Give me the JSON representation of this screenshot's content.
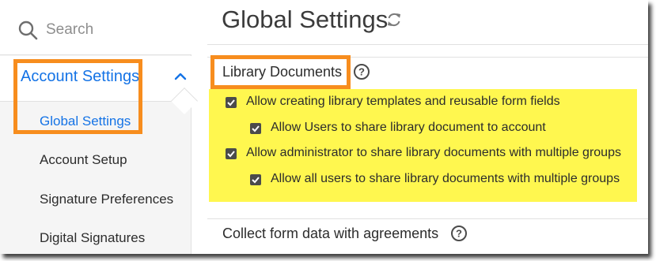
{
  "sidebar": {
    "search_label": "Search",
    "section": "Account Settings",
    "items": [
      {
        "label": "Global Settings",
        "active": true
      },
      {
        "label": "Account Setup",
        "active": false
      },
      {
        "label": "Signature Preferences",
        "active": false
      },
      {
        "label": "Digital Signatures",
        "active": false
      }
    ]
  },
  "main": {
    "title": "Global Settings",
    "library": {
      "title": "Library Documents",
      "options": [
        {
          "label": "Allow creating library templates and reusable form fields",
          "checked": true
        },
        {
          "label": "Allow Users to share library document to account",
          "checked": true
        },
        {
          "label": "Allow administrator to share library documents with multiple groups",
          "checked": true
        },
        {
          "label": "Allow all users to share library documents with multiple groups",
          "checked": true
        }
      ]
    },
    "collect": {
      "title": "Collect form data with agreements"
    }
  },
  "colors": {
    "accent": "#1473e6",
    "highlight_box": "#f78d1e",
    "highlight_fill": "#fff74f",
    "checkbox": "#4b4b4b"
  },
  "icons": {
    "search": "search-icon",
    "chevron": "chevron-up-icon",
    "refresh": "refresh-icon",
    "help": "help-icon",
    "checkbox": "checkbox-checked-icon"
  }
}
